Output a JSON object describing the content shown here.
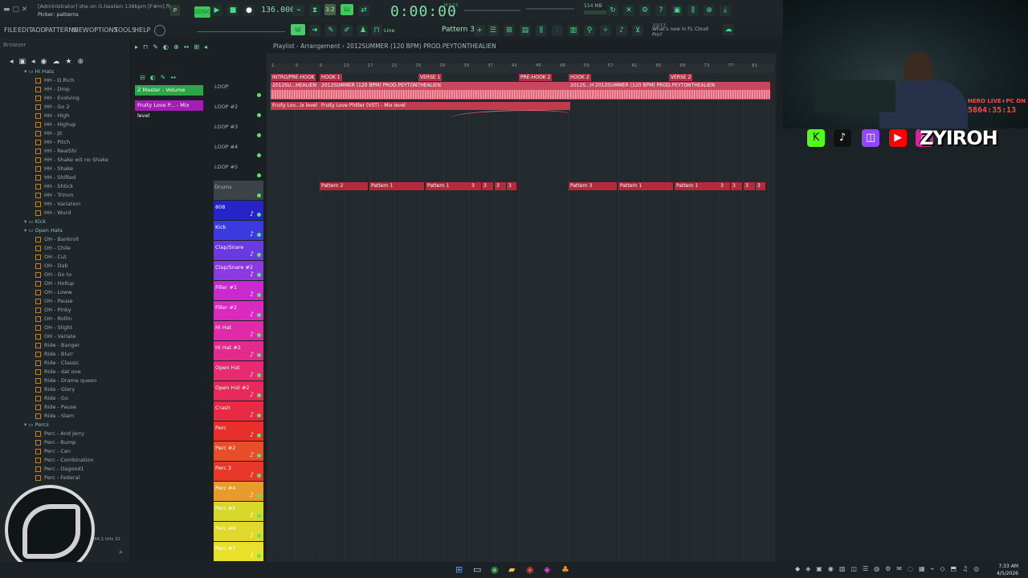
{
  "title": {
    "admin": "[Administrator] she on G.healien 136bpm [F#m].flp",
    "hint": "Picker: patterns"
  },
  "menu": [
    "FILE",
    "EDIT",
    "ADD",
    "PATTERNS",
    "VIEW",
    "OPTIONS",
    "TOOLS",
    "HELP"
  ],
  "transport": {
    "bpm": "136.000",
    "time": "0:00:00",
    "time_sub": "M:S:CS",
    "pattern": "Pattern 3",
    "snap": "Line",
    "memory": "514 MB",
    "cpu": "0"
  },
  "news": {
    "counter": "03/13",
    "text": "What's new in FL Cloud Pro?"
  },
  "playlist": {
    "title": "Playlist - Arrangement › 2012SUMMER (120 BPM) PROD.PEYTONTHEALIEN"
  },
  "browser": {
    "label": "Browser",
    "folder_hihats": "Hi Hats",
    "hihats": [
      "HH - D.Rich",
      "HH - Drop",
      "HH - Evolving",
      "HH - Go 2",
      "HH - High",
      "HH - Highup",
      "HH - Jit",
      "HH - Pitch",
      "HH - RealShi",
      "HH - Shake wit no Shake",
      "HH - Shake",
      "HH - Shifted",
      "HH - Shtick",
      "HH - Trimm",
      "HH - Variation",
      "HH - Wurd"
    ],
    "folder_kick": "Kick",
    "folder_openhats": "Open Hats",
    "openhats": [
      "OH - Bankroll",
      "OH - Chile",
      "OH - Cut",
      "OH - Dab",
      "OH - Go to",
      "OH - Hollup",
      "OH - Loww",
      "OH - Pause",
      "OH - Pinky",
      "OH - Rollin",
      "OH - Slight",
      "OH - Variate",
      "Ride - Banger",
      "Ride - Blurr",
      "Ride - Classic",
      "Ride - dat one",
      "Ride - Drama queen",
      "Ride - Glory",
      "Ride - Go",
      "Ride - Pause",
      "Ride - Slam"
    ],
    "folder_percs": "Percs",
    "percs": [
      "Perc - And Jerry",
      "Perc - Bump",
      "Perc - Can",
      "Perc - Combination",
      "Perc - Dagood1",
      "Perc - Federal"
    ]
  },
  "automation": {
    "master_volume": "Z Master - Volume",
    "fruity_love": "Fruity Love P... - Mix level"
  },
  "channels": {
    "plain": [
      "LOOP",
      "LOOP #2",
      "LOOP #3",
      "LOOP #4",
      "LOOP #5",
      "Drums"
    ],
    "colored": [
      {
        "name": "808",
        "color": "#2424c8"
      },
      {
        "name": "Kick",
        "color": "#3a3ae0"
      },
      {
        "name": "Clap/Snare",
        "color": "#6a3ae0"
      },
      {
        "name": "Clap/Snare #2",
        "color": "#8a3ae0"
      },
      {
        "name": "Filler #1",
        "color": "#c82ad0"
      },
      {
        "name": "Filler #2",
        "color": "#d82ac0"
      },
      {
        "name": "Hi Hat",
        "color": "#e02aa8"
      },
      {
        "name": "Hi Hat #2",
        "color": "#e42a8c"
      },
      {
        "name": "Open Hat",
        "color": "#e82a70"
      },
      {
        "name": "Open Hat #2",
        "color": "#e82a5a"
      },
      {
        "name": "Crash",
        "color": "#e82a44"
      },
      {
        "name": "Perc",
        "color": "#e8302a"
      },
      {
        "name": "Perc #2",
        "color": "#e84e2a"
      },
      {
        "name": "Perc 3",
        "color": "#e8382a"
      },
      {
        "name": "Perc #4",
        "color": "#e89a2a"
      },
      {
        "name": "Perc #5",
        "color": "#d8d82a"
      },
      {
        "name": "Perc #6",
        "color": "#e0d82a"
      },
      {
        "name": "Perc #7",
        "color": "#e8e02a"
      }
    ]
  },
  "ruler": [
    "1",
    "5",
    "9",
    "13",
    "17",
    "21",
    "25",
    "29",
    "33",
    "37",
    "41",
    "45",
    "49",
    "53",
    "57",
    "61",
    "65",
    "69",
    "73",
    "77",
    "81"
  ],
  "markers": [
    {
      "label": "INTRO/PRE-HOOK"
    },
    {
      "label": "HOOK 1"
    },
    {
      "label": "VERSE 1"
    },
    {
      "label": "PRE-HOOK 2"
    },
    {
      "label": "HOOK 2"
    },
    {
      "label": "VERSE 2"
    }
  ],
  "audio_clips": [
    {
      "label": "2012SU...HEALIEN"
    },
    {
      "label": "2012SUMMER (120 BPM) PROD.PEYTONTHEALIEN"
    },
    {
      "label": "2012S...HEALIEN"
    },
    {
      "label": "2012SUMMER (120 BPM) PROD.PEYTONTHEALIEN"
    }
  ],
  "auto_clips": [
    "Fruity Lov...ix level",
    "Fruity Love Philter (VST) - Mix level"
  ],
  "patterns": [
    "Pattern 2",
    "Pattern 1",
    "Pattern 1",
    "3",
    "3",
    "3",
    "3",
    "Pattern 3",
    "Pattern 1",
    "Pattern 1",
    "3",
    "3",
    "3",
    "3"
  ],
  "overlay": {
    "handle": "ZYIROH",
    "live": "HERO LIVE+PC ON",
    "timer": "5864:35:13"
  },
  "taskbar": {
    "time": "7:33 AM",
    "date": "4/5/2026"
  },
  "mixer_label": "44.1 kHz 32"
}
